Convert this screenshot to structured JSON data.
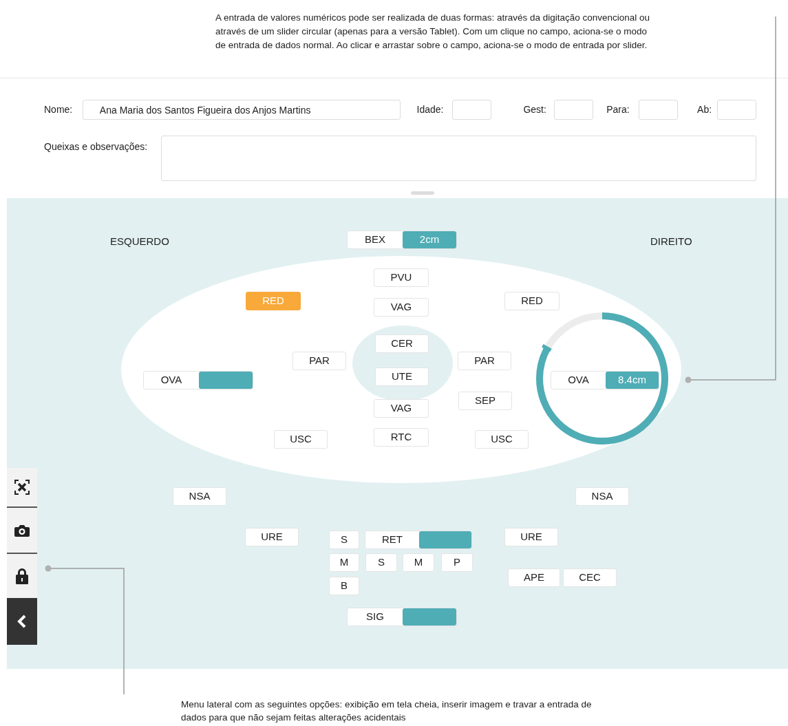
{
  "top_note": {
    "lines": [
      "A entrada de valores numéricos pode ser realizada de duas formas: através da digitação convencional ou",
      "através de um slider circular (apenas para a versão Tablet). Com um clique no campo, aciona-se o modo",
      "de entrada de dados normal. Ao clicar e arrastar sobre o campo, aciona-se o modo de entrada por slider."
    ]
  },
  "form": {
    "name": {
      "label": "Nome:",
      "value": "Ana Maria dos Santos Figueira dos Anjos Martins"
    },
    "fields": [
      {
        "label": "Idade:"
      },
      {
        "label": "Gest:"
      },
      {
        "label": "Para:"
      },
      {
        "label": "Ab:"
      }
    ],
    "complaints": {
      "label": "Queixas e observações:"
    }
  },
  "diagram": {
    "side_labels": [
      "ESQUERDO",
      "DIREITO"
    ],
    "nodes": [
      {
        "kind": "measure",
        "label": "BEX",
        "value": "2cm"
      },
      {
        "kind": "tag",
        "label": "PVU",
        "highlighted": false
      },
      {
        "kind": "tag",
        "label": "RED",
        "highlighted": true
      },
      {
        "kind": "tag",
        "label": "RED",
        "highlighted": false
      },
      {
        "kind": "tag",
        "label": "VAG",
        "highlighted": false
      },
      {
        "kind": "tag",
        "label": "CER",
        "highlighted": false
      },
      {
        "kind": "tag",
        "label": "PAR",
        "highlighted": false
      },
      {
        "kind": "tag",
        "label": "PAR",
        "highlighted": false
      },
      {
        "kind": "measure",
        "label": "OVA"
      },
      {
        "kind": "tag",
        "label": "UTE",
        "highlighted": false
      },
      {
        "kind": "measure",
        "label": "OVA",
        "value": "8.4cm",
        "dial": true
      },
      {
        "kind": "tag",
        "label": "SEP",
        "highlighted": false
      },
      {
        "kind": "tag",
        "label": "VAG",
        "highlighted": false
      },
      {
        "kind": "tag",
        "label": "USC",
        "highlighted": false
      },
      {
        "kind": "tag",
        "label": "RTC",
        "highlighted": false
      },
      {
        "kind": "tag",
        "label": "USC",
        "highlighted": false
      },
      {
        "kind": "tag",
        "label": "NSA",
        "highlighted": false
      },
      {
        "kind": "tag",
        "label": "NSA",
        "highlighted": false
      },
      {
        "kind": "tag",
        "label": "URE",
        "highlighted": false
      },
      {
        "kind": "tag",
        "label": "S",
        "highlighted": false
      },
      {
        "kind": "measure",
        "label": "RET"
      },
      {
        "kind": "tag",
        "label": "URE",
        "highlighted": false
      },
      {
        "kind": "tag",
        "label": "M",
        "highlighted": false
      },
      {
        "kind": "tag",
        "label": "S",
        "highlighted": false
      },
      {
        "kind": "tag",
        "label": "M",
        "highlighted": false
      },
      {
        "kind": "tag",
        "label": "P",
        "highlighted": false
      },
      {
        "kind": "tag",
        "label": "APE",
        "highlighted": false
      },
      {
        "kind": "tag",
        "label": "CEC",
        "highlighted": false
      },
      {
        "kind": "tag",
        "label": "B",
        "highlighted": false
      },
      {
        "kind": "measure",
        "label": "SIG"
      }
    ]
  },
  "side_menu": [
    {
      "kind": "fullscreen"
    },
    {
      "kind": "camera"
    },
    {
      "kind": "lock"
    },
    {
      "kind": "collapse"
    }
  ],
  "bottom_note": {
    "lines": [
      "Menu lateral com as seguintes opções: exibição em tela cheia, inserir imagem e travar a entrada de",
      "dados para que não sejam feitas alterações acidentais"
    ]
  }
}
